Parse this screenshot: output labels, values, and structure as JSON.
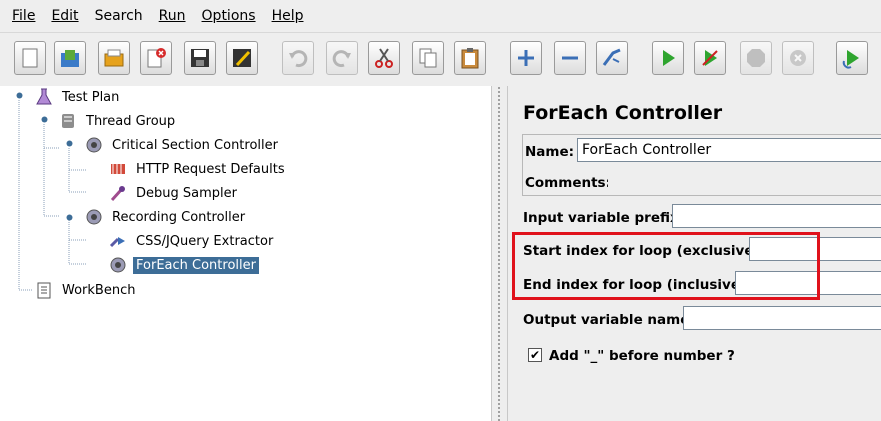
{
  "menu": [
    "File",
    "Edit",
    "Search",
    "Run",
    "Options",
    "Help"
  ],
  "toolbar": {
    "buttons": [
      "new-icon",
      "templates-icon",
      "open-icon",
      "close-icon",
      "save-icon",
      "save-as-icon",
      "undo-icon",
      "redo-icon",
      "cut-icon",
      "copy-icon",
      "paste-icon",
      "expand-icon",
      "collapse-icon",
      "toggle-icon",
      "start-icon",
      "start-no-pause-icon",
      "stop-icon",
      "shutdown-icon",
      "remote-start-icon"
    ]
  },
  "tree": {
    "items": [
      {
        "label": "Test Plan",
        "icon": "test-plan-icon"
      },
      {
        "label": "Thread Group",
        "icon": "thread-group-icon"
      },
      {
        "label": "Critical Section Controller",
        "icon": "controller-icon"
      },
      {
        "label": "HTTP Request Defaults",
        "icon": "config-icon"
      },
      {
        "label": "Debug Sampler",
        "icon": "sampler-icon"
      },
      {
        "label": "Recording Controller",
        "icon": "controller-icon"
      },
      {
        "label": "CSS/JQuery Extractor",
        "icon": "extractor-icon"
      },
      {
        "label": "ForEach Controller",
        "icon": "controller-icon",
        "selected": true
      },
      {
        "label": "WorkBench",
        "icon": "workbench-icon"
      }
    ]
  },
  "form": {
    "title": "ForEach Controller",
    "name_label": "Name:",
    "name_value": "ForEach Controller",
    "comments_label": "Comments:",
    "input_prefix_label": "Input variable prefix",
    "start_index_label": "Start index for loop (exclusive)",
    "end_index_label": "End index for loop (inclusive)",
    "output_var_label": "Output variable name",
    "add_underscore_label": "Add \"_\" before number ?",
    "add_underscore_checked": true,
    "checkmark": "✔"
  },
  "colors": {
    "selection": "#3d6d97",
    "highlight": "#e0111b"
  }
}
